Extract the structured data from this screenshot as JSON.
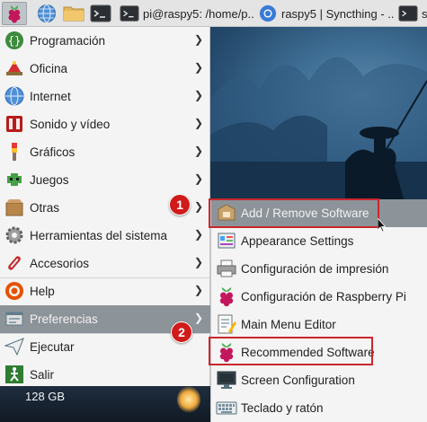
{
  "taskbar": {
    "tasks": [
      {
        "label": "pi@raspy5: /home/p..",
        "icon": "terminal-icon"
      },
      {
        "label": "raspy5 | Syncthing - ..",
        "icon": "chromium-icon"
      },
      {
        "label": "s",
        "icon": "terminal-icon"
      }
    ]
  },
  "menu": {
    "items": [
      {
        "label": "Programación",
        "icon": "programming-icon",
        "submenu": true
      },
      {
        "label": "Oficina",
        "icon": "office-icon",
        "submenu": true
      },
      {
        "label": "Internet",
        "icon": "globe-icon",
        "submenu": true
      },
      {
        "label": "Sonido y vídeo",
        "icon": "multimedia-icon",
        "submenu": true
      },
      {
        "label": "Gráficos",
        "icon": "graphics-icon",
        "submenu": true
      },
      {
        "label": "Juegos",
        "icon": "games-icon",
        "submenu": true
      },
      {
        "label": "Otras",
        "icon": "box-icon",
        "submenu": true
      },
      {
        "label": "Herramientas del sistema",
        "icon": "system-tools-icon",
        "submenu": true
      },
      {
        "label": "Accesorios",
        "icon": "accessories-icon",
        "submenu": true
      },
      {
        "label": "Help",
        "icon": "help-icon",
        "submenu": true
      },
      {
        "label": "Preferencias",
        "icon": "preferences-icon",
        "submenu": true,
        "selected": true
      },
      {
        "label": "Ejecutar",
        "icon": "run-icon",
        "submenu": false
      },
      {
        "label": "Salir",
        "icon": "logout-icon",
        "submenu": false
      }
    ]
  },
  "submenu": {
    "items": [
      {
        "label": "Add / Remove Software",
        "icon": "software-icon",
        "selected": true
      },
      {
        "label": "Appearance Settings",
        "icon": "appearance-icon"
      },
      {
        "label": "Configuración de impresión",
        "icon": "printer-icon"
      },
      {
        "label": "Configuración de Raspberry Pi",
        "icon": "raspberry-icon"
      },
      {
        "label": "Main Menu Editor",
        "icon": "menu-editor-icon"
      },
      {
        "label": "Recommended Software",
        "icon": "raspberry-icon"
      },
      {
        "label": "Screen Configuration",
        "icon": "monitor-icon"
      },
      {
        "label": "Teclado y ratón",
        "icon": "keyboard-icon"
      }
    ]
  },
  "desktop": {
    "drive_label": "128 GB"
  },
  "annotations": {
    "badge1": "1",
    "badge2": "2"
  },
  "colors": {
    "highlight": "#c9272d",
    "selected_bg": "#8c9399",
    "badge": "#d11a1a"
  }
}
